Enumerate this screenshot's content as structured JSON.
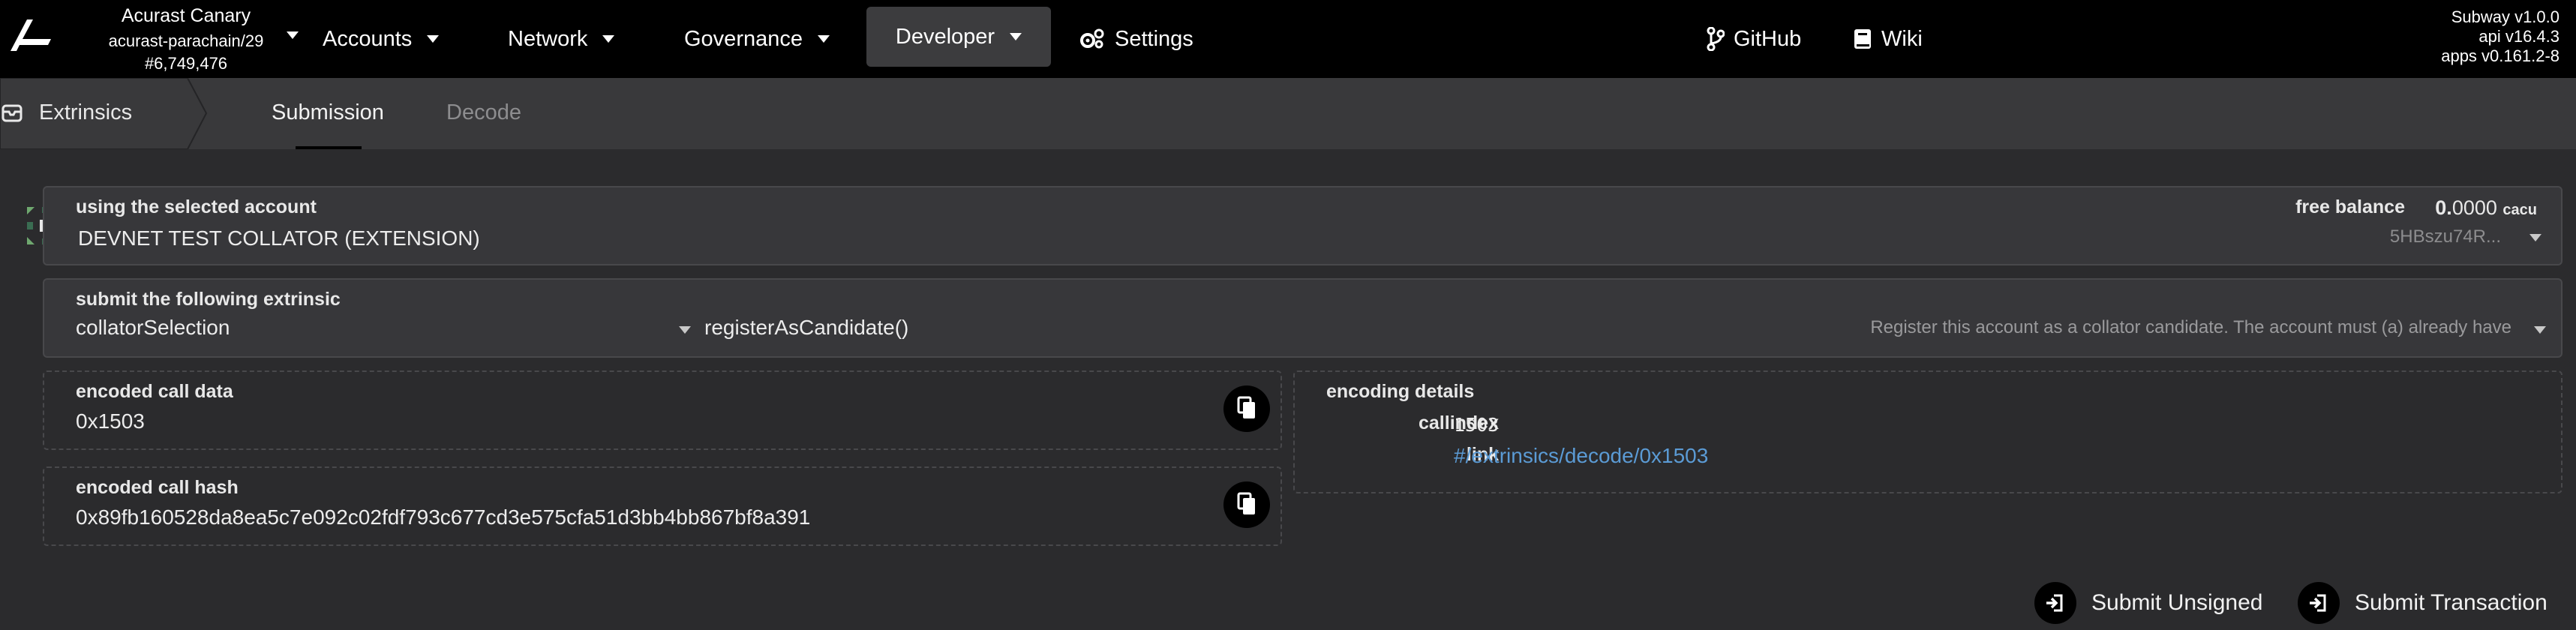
{
  "header": {
    "chain_name": "Acurast Canary",
    "chain_spec": "acurast-parachain/29",
    "block_number": "#6,749,476",
    "nav": {
      "accounts": "Accounts",
      "network": "Network",
      "governance": "Governance",
      "developer": "Developer",
      "settings": "Settings",
      "github": "GitHub",
      "wiki": "Wiki"
    },
    "version": {
      "subway": "Subway v1.0.0",
      "api": "api v16.4.3",
      "apps": "apps v0.161.2-8"
    }
  },
  "subnav": {
    "section": "Extrinsics",
    "tabs": [
      "Submission",
      "Decode"
    ]
  },
  "account": {
    "label": "using the selected account",
    "name": "DEVNET TEST COLLATOR (EXTENSION)",
    "balance_label": "free balance",
    "balance_int": "0.",
    "balance_dec": "0000",
    "balance_unit": "cacu",
    "address_short": "5HBszu74R..."
  },
  "extrinsic": {
    "label": "submit the following extrinsic",
    "pallet": "collatorSelection",
    "call": "registerAsCandidate()",
    "doc": "Register this account as a collator candidate. The account must (a) already have"
  },
  "encoded_call": {
    "label": "encoded call data",
    "value": "0x1503"
  },
  "encoded_hash": {
    "label": "encoded call hash",
    "value": "0x89fb160528da8ea5c7e092c02fdf793c677cd3e575cfa51d3bb4bb867bf8a391"
  },
  "encoding": {
    "label": "encoding details",
    "callindex_label": "callindex",
    "callindex_value": "1503",
    "link_label": "link",
    "link_value": "#/extrinsics/decode/0x1503"
  },
  "actions": {
    "submit_unsigned": "Submit Unsigned",
    "submit_transaction": "Submit Transaction"
  },
  "colors": {
    "topbar": "#000000",
    "background": "#2b2b2d",
    "panel": "#37373a",
    "link": "#5b9bd5"
  }
}
